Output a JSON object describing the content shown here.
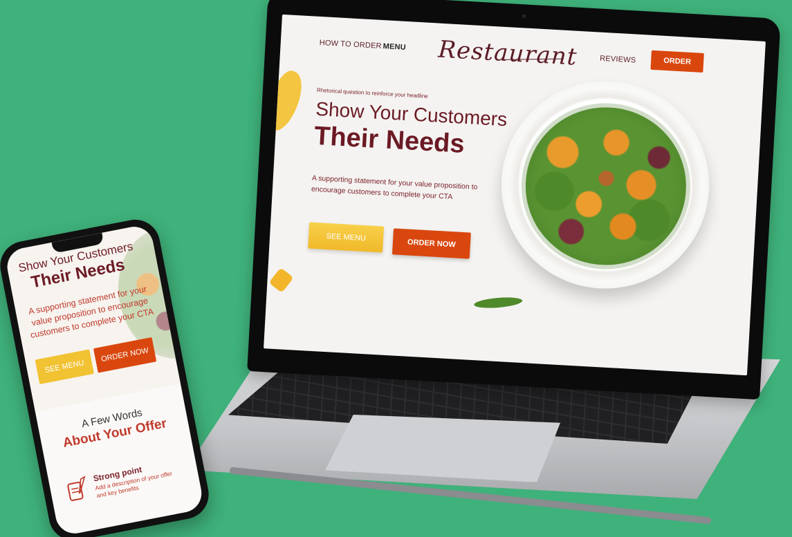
{
  "laptop_site": {
    "nav": {
      "how_to_order": "HOW TO ORDER",
      "menu": "MENU",
      "logo": "Restaurant",
      "reviews": "REVIEWS",
      "order": "ORDER"
    },
    "hero": {
      "eyebrow": "Rhetorical question to reinforce your headline",
      "headline_line1": "Show Your Customers",
      "headline_line2": "Their Needs",
      "support_text": "A supporting statement for your value proposition to encourage customers to complete your CTA",
      "see_menu": "SEE MENU",
      "order_now": "ORDER NOW"
    }
  },
  "phone_site": {
    "headline_line1": "Show Your Customers",
    "headline_line2": "Their Needs",
    "support_text": "A supporting statement for your value proposition to encourage customers to complete your CTA",
    "see_menu": "SEE MENU",
    "order_now": "ORDER NOW",
    "offer_intro": "A Few Words",
    "offer_title": "About Your Offer",
    "strong_point_title": "Strong point",
    "strong_point_desc": "Add a description of your offer and key benefits",
    "strong_point_icon": "scroll-quill-icon"
  },
  "colors": {
    "background": "#3fb17a",
    "brand_maroon": "#6b1a24",
    "cta_orange": "#d9470e",
    "cta_yellow": "#f1c232"
  }
}
